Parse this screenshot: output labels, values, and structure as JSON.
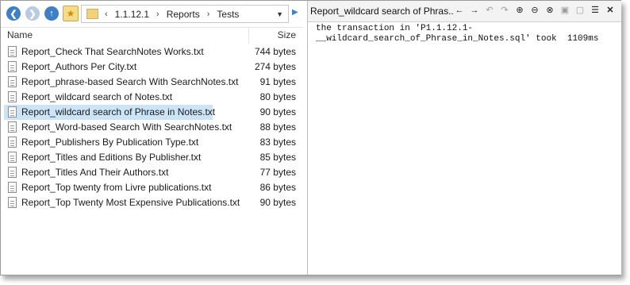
{
  "address": {
    "crumbs": [
      "1.1.12.1",
      "Reports",
      "Tests"
    ]
  },
  "list": {
    "col_name": "Name",
    "col_size": "Size",
    "files": [
      {
        "name": "Report_Check That SearchNotes Works.txt",
        "size": "744 bytes",
        "selected": false
      },
      {
        "name": "Report_Authors Per City.txt",
        "size": "274 bytes",
        "selected": false
      },
      {
        "name": "Report_phrase-based Search With SearchNotes.txt",
        "size": "91 bytes",
        "selected": false
      },
      {
        "name": "Report_wildcard search of Notes.txt",
        "size": "80 bytes",
        "selected": false
      },
      {
        "name": "Report_wildcard search of Phrase in Notes.txt",
        "size": "90 bytes",
        "selected": true
      },
      {
        "name": "Report_Word-based Search With SearchNotes.txt",
        "size": "88 bytes",
        "selected": false
      },
      {
        "name": "Report_Publishers By Publication Type.txt",
        "size": "83 bytes",
        "selected": false
      },
      {
        "name": "Report_Titles and Editions By Publisher.txt",
        "size": "85 bytes",
        "selected": false
      },
      {
        "name": "Report_Titles And Their Authors.txt",
        "size": "77 bytes",
        "selected": false
      },
      {
        "name": "Report_Top twenty from Livre publications.txt",
        "size": "86 bytes",
        "selected": false
      },
      {
        "name": "Report_Top Twenty Most Expensive Publications.txt",
        "size": "90 bytes",
        "selected": false
      }
    ]
  },
  "viewer": {
    "title": "Report_wildcard search of Phras...",
    "content_line1": "the transaction in 'P1.1.12.1-",
    "content_line2": "__wildcard_search_of_Phrase_in_Notes.sql' took  1109ms"
  },
  "colors": {
    "accent": "#3f7fc4",
    "selection": "#cce4f7",
    "folder": "#f1d27a"
  },
  "icons": [
    "back-icon",
    "forward-icon",
    "up-icon",
    "favorites-icon",
    "folder-icon",
    "file-icon",
    "arrow-left-icon",
    "arrow-right-icon",
    "undo-icon",
    "redo-icon",
    "zoom-in-icon",
    "zoom-out-icon",
    "zoom-reset-icon",
    "restore-icon",
    "maximize-icon",
    "menu-icon",
    "close-icon"
  ]
}
